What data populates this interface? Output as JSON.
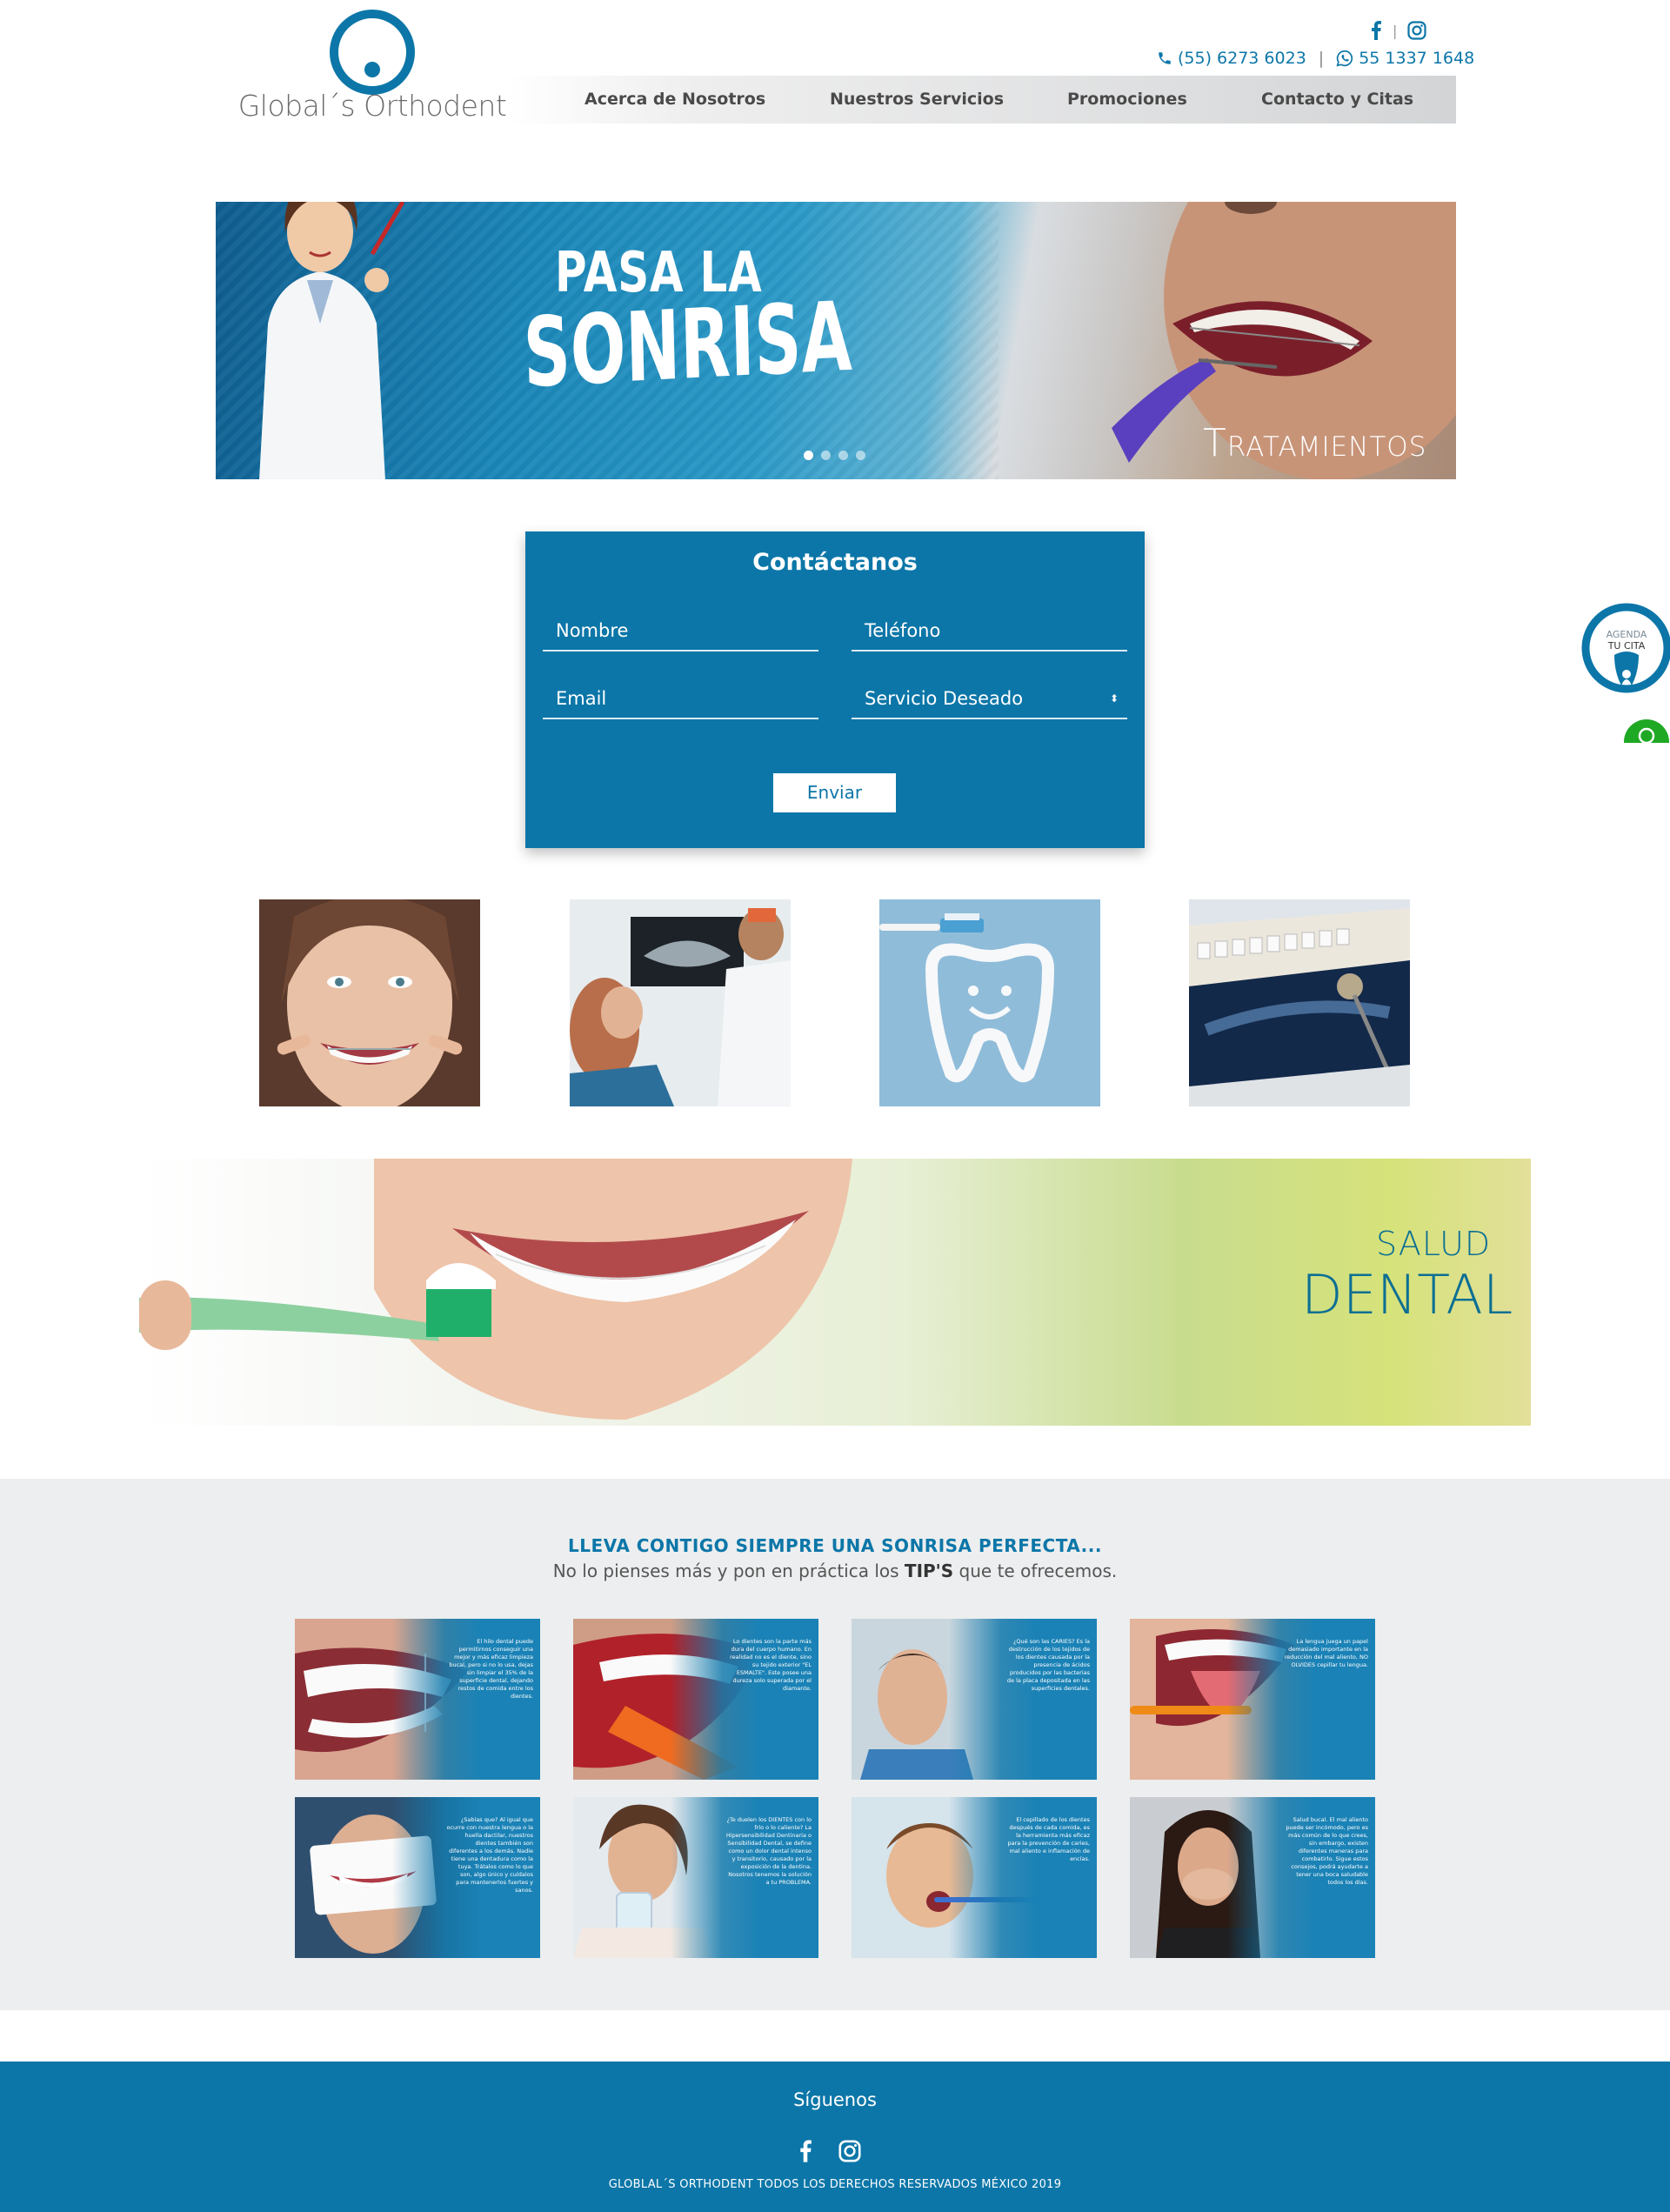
{
  "brand": {
    "name": "Global´s Orthodent"
  },
  "top_bar": {
    "phone": "(55) 6273 6023",
    "separator": "|",
    "whatsapp": "55 1337 1648",
    "social_separator": "|"
  },
  "nav": {
    "items": [
      {
        "label": "Acerca de Nosotros"
      },
      {
        "label": "Nuestros Servicios"
      },
      {
        "label": "Promociones"
      },
      {
        "label": "Contacto y Citas"
      }
    ]
  },
  "hero": {
    "title_line1": "PASA LA",
    "title_line2": "SONRISA",
    "caption": "Tratamientos",
    "slides": 4,
    "active_slide": 1
  },
  "contact_form": {
    "title": "Contáctanos",
    "name_placeholder": "Nombre",
    "phone_placeholder": "Teléfono",
    "email_placeholder": "Email",
    "service_selected": "Servicio Deseado",
    "submit_label": "Enviar"
  },
  "side_widget": {
    "agenda_line1": "AGENDA",
    "agenda_line2": "TU CITA"
  },
  "banner": {
    "line1": "SALUD",
    "line2": "DENTAL"
  },
  "tips": {
    "heading": "LLEVA CONTIGO SIEMPRE UNA SONRISA PERFECTA...",
    "sub_before": "No lo pienses más y pon en práctica los ",
    "sub_bold": "TIP'S",
    "sub_after": " que te ofrecemos.",
    "cards": [
      {
        "text": "El hilo dental puede permitirnos conseguir una mejor y más eficaz limpieza bucal, pero si no lo usa, dejas sin limpiar el 35% de la superficie dental, dejando restos de comida entre los dientes."
      },
      {
        "text": "Lo dientes son la parte más dura del cuerpo humano. En realidad no es el diente, sino su tejido exterior \"EL ESMALTE\". Este posee una dureza solo superada por el diamante."
      },
      {
        "text": "¿Qué son las CARIES? Es la destrucción de los tejidos de los dientes causada por la presencia de ácidos producidos por las bacterias de la placa depositada en las superficies dentales."
      },
      {
        "text": "La lengua juega un papel demasiado importante en la reducción del mal aliento, NO OLVIDES cepillar tu lengua."
      },
      {
        "text": "¿Sabías que? Al igual que ocurre con nuestra lengua o la huella dactilar, nuestros dientes también son diferentes a los demás. Nadie tiene una dentadura como la tuya. Trátalos como lo que son, algo único y cuídalos para mantenerlos fuertes y sanos."
      },
      {
        "text": "¿Te duelen los DIENTES con lo frío o lo caliente? La Hipersensibilidad Dentinaria o Sensibilidad Dental, se define como un dolor dental intenso y transitorio, causado por la exposición de la dentina. Nosotros tenemos la solución a tu PROBLEMA."
      },
      {
        "text": "El cepillado de los dientes después de cada comida, es la herramienta más eficaz para la prevención de caries, mal aliento e inflamación de encías."
      },
      {
        "text": "Salud bucal. El mal aliento puede ser incómodo, pero es más común de lo que crees, sin embargo, existen diferentes maneras para combatirlo. Sigue estos consejos, podrá ayudarte a tener una boca saludable todos los días."
      }
    ]
  },
  "footer": {
    "follow": "Síguenos",
    "copyright": "GLOBLAL´S ORTHODENT TODOS LOS DERECHOS RESERVADOS MÉXICO 2019"
  },
  "colors": {
    "primary": "#0c76a8",
    "nav_text": "#4a4a4a",
    "tips_bg": "#eceeef",
    "whatsapp": "#1fa824"
  }
}
